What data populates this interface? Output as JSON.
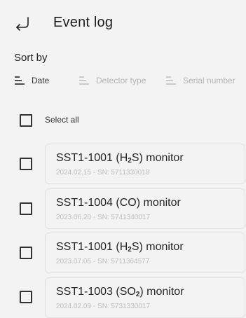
{
  "header": {
    "title": "Event log",
    "back_icon": "return-arrow-icon"
  },
  "sort": {
    "label": "Sort by",
    "options": [
      {
        "label": "Date",
        "active": true,
        "icon": "sort-lines-icon"
      },
      {
        "label": "Detector type",
        "active": false,
        "icon": "sort-lines-icon"
      },
      {
        "label": "Serial number",
        "active": false,
        "icon": "sort-lines-icon"
      }
    ]
  },
  "select_all": {
    "label": "Select all",
    "checked": false
  },
  "events": [
    {
      "model": "SST1-1001 (",
      "gas_main": "H",
      "gas_sub": "2",
      "gas_tail": "S) monitor",
      "date": "2024.02.15",
      "sn_label": "SN:",
      "sn": "5711330018",
      "checked": false
    },
    {
      "model": "SST1-1004 (",
      "gas_main": "CO",
      "gas_sub": "",
      "gas_tail": ") monitor",
      "date": "2023.06.20",
      "sn_label": "SN:",
      "sn": "5741340017",
      "checked": false
    },
    {
      "model": "SST1-1001 (",
      "gas_main": "H",
      "gas_sub": "2",
      "gas_tail": "S) monitor",
      "date": "2023.07.05",
      "sn_label": "SN:",
      "sn": "5711364577",
      "checked": false
    },
    {
      "model": "SST1-1003 (",
      "gas_main": "SO",
      "gas_sub": "2",
      "gas_tail": ") monitor",
      "date": "2024.02.09",
      "sn_label": "SN:",
      "sn": "5731330017",
      "checked": false
    }
  ],
  "colors": {
    "background": "#f4f3f3",
    "text": "#1d1d1d",
    "muted": "#bcbcbc",
    "card_border": "#e2dede"
  }
}
